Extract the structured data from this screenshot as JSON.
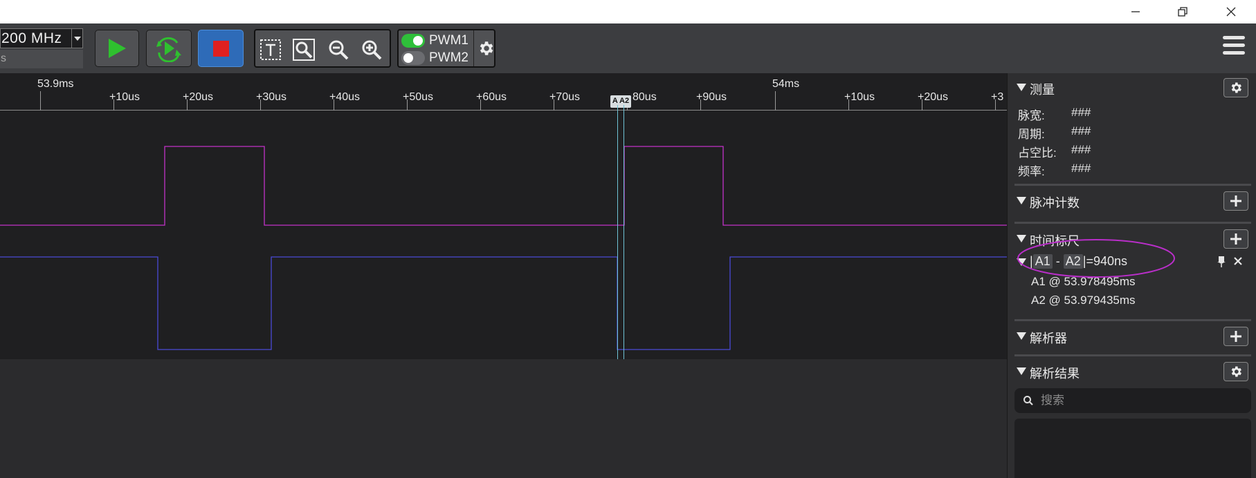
{
  "toolbar": {
    "sample_rate": "200 MHz",
    "sample_rate_sub": "s",
    "pwm": [
      {
        "label": "PWM1",
        "on": true
      },
      {
        "label": "PWM2",
        "on": false
      }
    ]
  },
  "ruler": {
    "major_labels": [
      "53.9ms",
      "54ms"
    ],
    "tick_labels": [
      "+10us",
      "+20us",
      "+30us",
      "+40us",
      "+50us",
      "+60us",
      "+70us",
      "80us",
      "+90us",
      "+10us",
      "+20us",
      "+3"
    ],
    "marker_flag": "A A2"
  },
  "panel": {
    "measure": {
      "title": "测量",
      "rows": [
        {
          "label": "脉宽:",
          "value": "###"
        },
        {
          "label": "周期:",
          "value": "###"
        },
        {
          "label": "占空比:",
          "value": "###"
        },
        {
          "label": "频率:",
          "value": "###"
        }
      ]
    },
    "pulse_count": {
      "title": "脉冲计数"
    },
    "time_ruler": {
      "title": "时间标尺",
      "cursor_a": "A1",
      "cursor_b": "A2",
      "bar_left": "|",
      "dash": "-",
      "bar_right": "|=",
      "delta": "940ns",
      "a1": "A1 @ 53.978495ms",
      "a2": "A2 @ 53.979435ms"
    },
    "decoder": {
      "title": "解析器"
    },
    "decode_results": {
      "title": "解析结果",
      "search_placeholder": "搜索"
    }
  },
  "colors": {
    "channel1": "#c232c8",
    "channel2": "#4a4ad6",
    "cursor": "#6fc3d6",
    "annotation": "#b92ec9"
  }
}
